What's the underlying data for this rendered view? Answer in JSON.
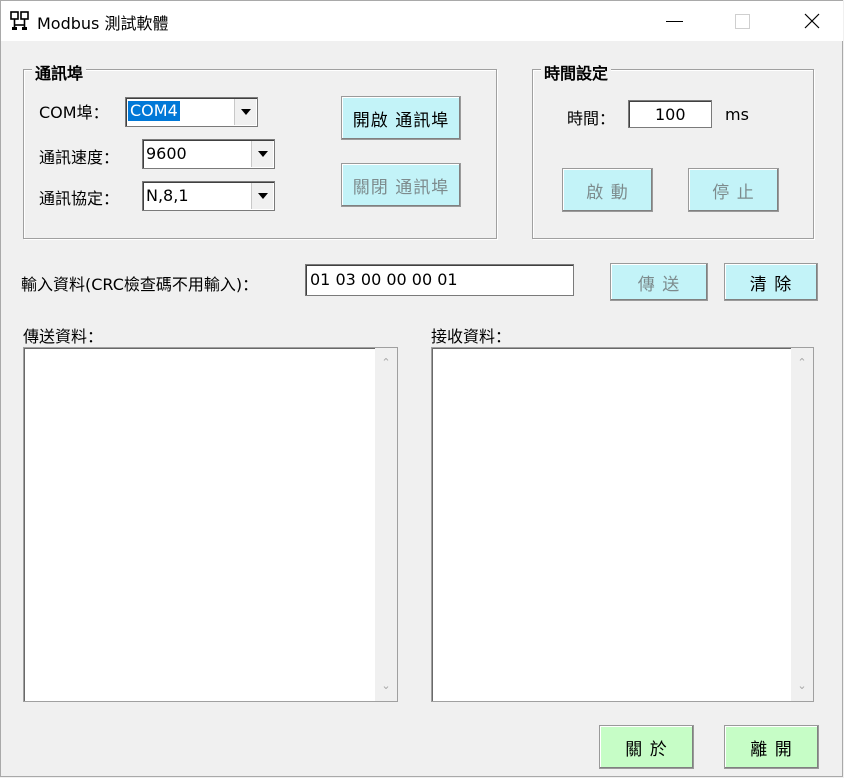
{
  "window": {
    "title": "Modbus 測試軟體",
    "icons": {
      "app": "modbus-app-icon",
      "minimize": "minimize-icon",
      "maximize": "maximize-icon",
      "close": "close-icon"
    },
    "accent_color": "#0078d7"
  },
  "comm_port_group": {
    "title": "通訊埠",
    "com_port_label": "COM埠：",
    "com_port_value": "COM4",
    "baud_label": "通訊速度：",
    "baud_value": "9600",
    "protocol_label": "通訊協定：",
    "protocol_value": "N,8,1",
    "open_button": "開啟 通訊埠",
    "close_button": "關閉 通訊埠"
  },
  "timer_group": {
    "title": "時間設定",
    "time_label": "時間：",
    "time_value": "100",
    "unit": "ms",
    "start_button": "啟 動",
    "stop_button": "停 止"
  },
  "input": {
    "label": "輸入資料(CRC檢查碼不用輸入)：",
    "value": "01 03 00 00 00 01",
    "send_button": "傳 送",
    "clear_button": "清 除"
  },
  "send_data": {
    "label": "傳送資料："
  },
  "receive_data": {
    "label": "接收資料："
  },
  "footer": {
    "about_button": "關 於",
    "exit_button": "離 開"
  },
  "colors": {
    "button_cyan": "#c3f3f8",
    "button_green": "#c6fdc6",
    "disabled_text": "#7d8b8d"
  }
}
